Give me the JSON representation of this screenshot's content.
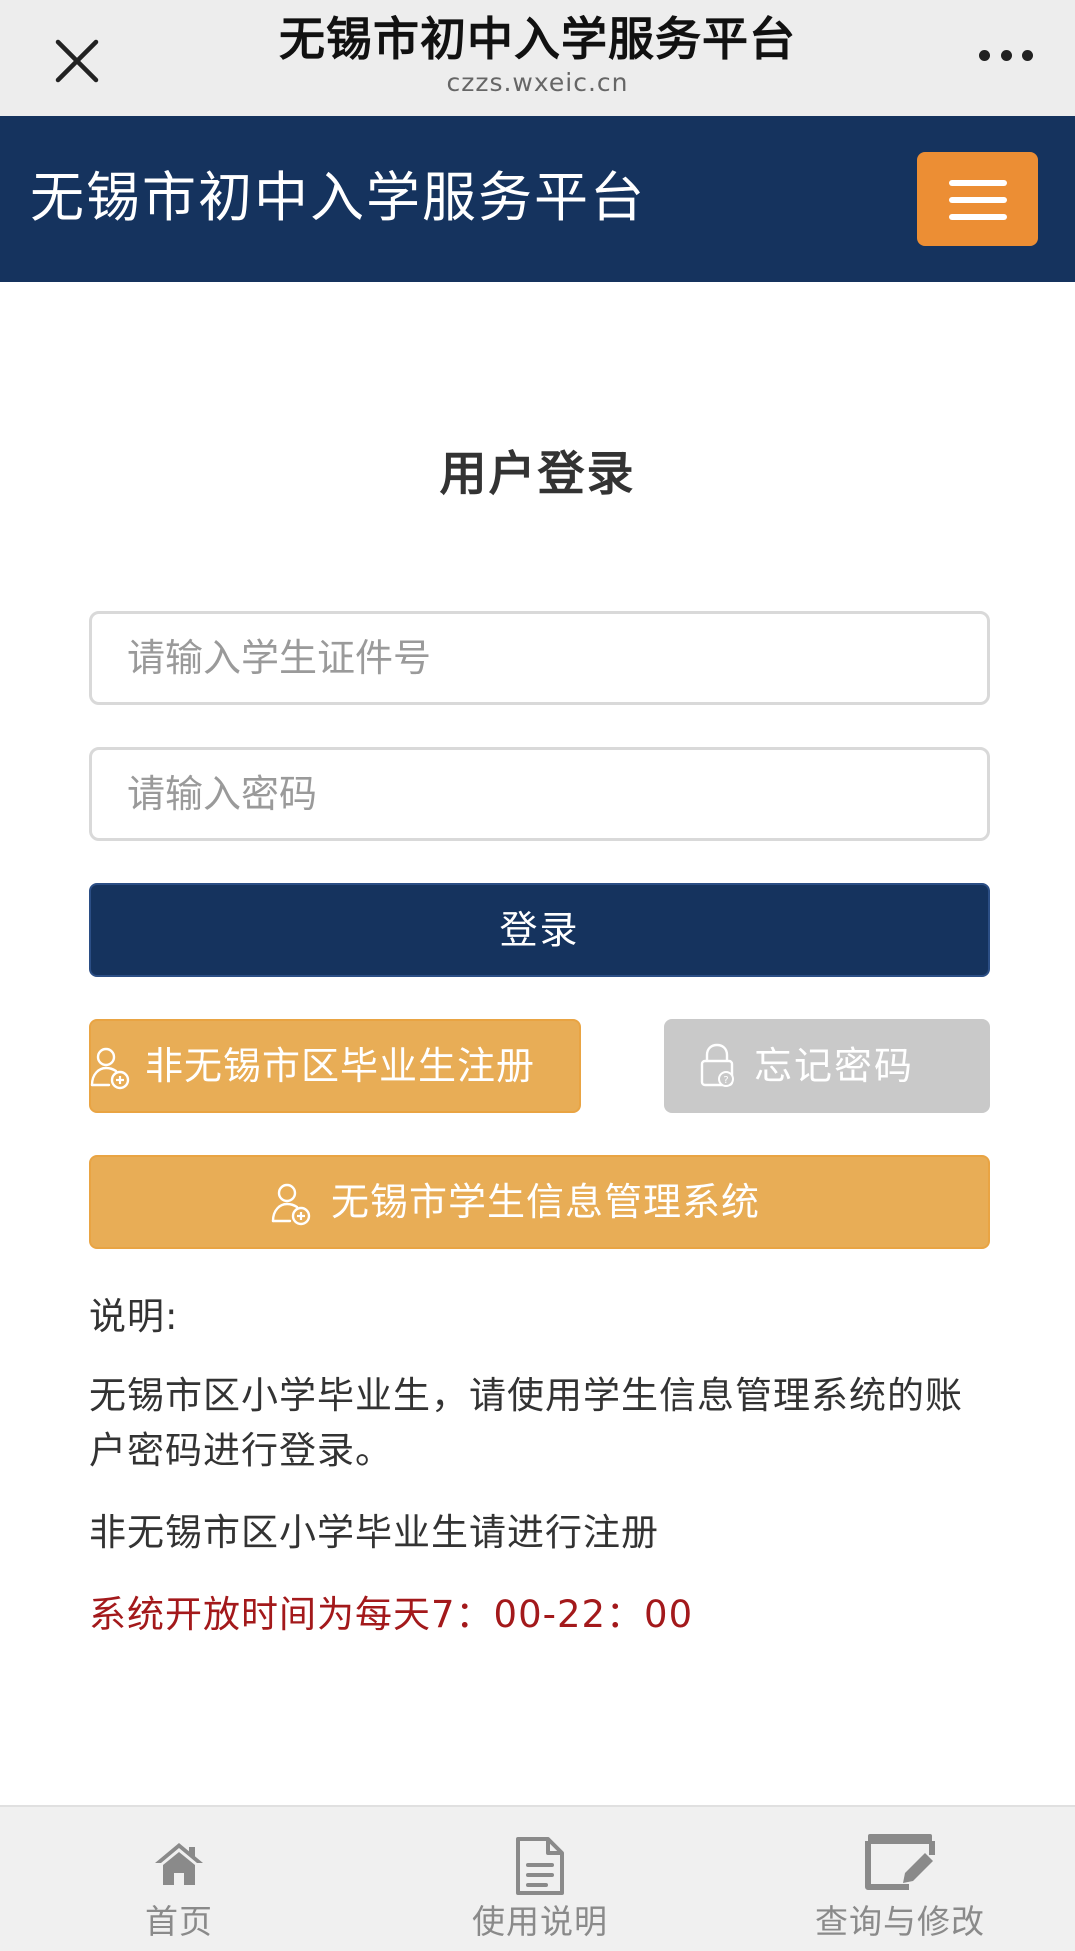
{
  "wechat_bar": {
    "title": "无锡市初中入学服务平台",
    "url": "czzs.wxeic.cn",
    "close_icon": "close-icon",
    "more_icon": "more-dots-icon"
  },
  "header": {
    "site_title": "无锡市初中入学服务平台",
    "menu_icon": "hamburger-menu-icon",
    "colors": {
      "background": "#15335e",
      "menu_button": "#ec8e34"
    }
  },
  "login": {
    "title": "用户登录",
    "id_placeholder": "请输入学生证件号",
    "id_value": "",
    "password_placeholder": "请输入密码",
    "password_value": "",
    "login_label": "登录",
    "register_label": "非无锡市区毕业生注册",
    "forgot_label": "忘记密码",
    "system_label": "无锡市学生信息管理系统",
    "colors": {
      "primary": "#15335e",
      "orange": "#e8ad56",
      "disabled": "#c9c9c9"
    }
  },
  "notes": {
    "heading": "说明:",
    "p1": "无锡市区小学毕业生，请使用学生信息管理系统的账户密码进行登录。",
    "p2": "非无锡市区小学毕业生请进行注册",
    "p3": "系统开放时间为每天7：00-22：00",
    "highlight_color": "#a3191b"
  },
  "bottom_nav": {
    "items": [
      {
        "label": "首页",
        "icon": "home-icon"
      },
      {
        "label": "使用说明",
        "icon": "document-icon"
      },
      {
        "label": "查询与修改",
        "icon": "edit-icon"
      }
    ]
  }
}
